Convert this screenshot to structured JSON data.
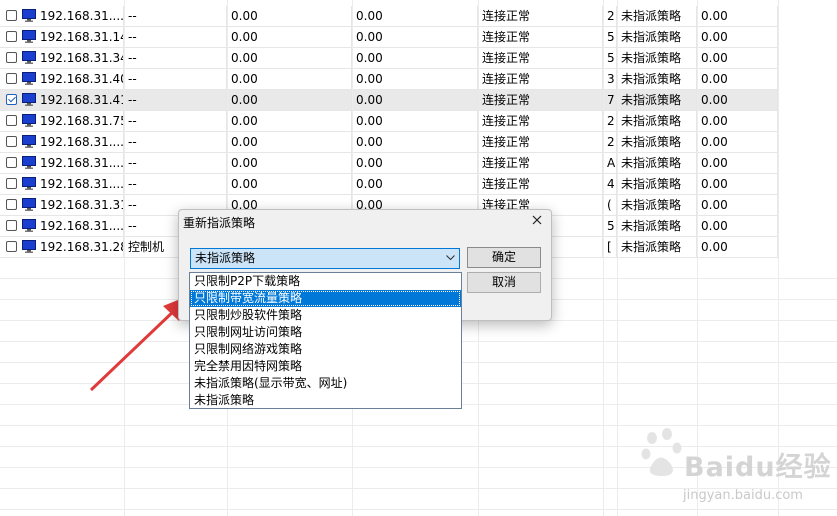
{
  "table": {
    "rows": [
      {
        "checked": false,
        "ip": "192.168.31....",
        "name": "--",
        "v1": "0.00",
        "v2": "0.00",
        "status": "连接正常",
        "col6": "2",
        "policy": "未指派策略",
        "v3": "0.00"
      },
      {
        "checked": false,
        "ip": "192.168.31.14",
        "name": "--",
        "v1": "0.00",
        "v2": "0.00",
        "status": "连接正常",
        "col6": "5",
        "policy": "未指派策略",
        "v3": "0.00"
      },
      {
        "checked": false,
        "ip": "192.168.31.34",
        "name": "--",
        "v1": "0.00",
        "v2": "0.00",
        "status": "连接正常",
        "col6": "5",
        "policy": "未指派策略",
        "v3": "0.00"
      },
      {
        "checked": false,
        "ip": "192.168.31.40",
        "name": "--",
        "v1": "0.00",
        "v2": "0.00",
        "status": "连接正常",
        "col6": "3",
        "policy": "未指派策略",
        "v3": "0.00"
      },
      {
        "checked": true,
        "ip": "192.168.31.41",
        "name": "--",
        "v1": "0.00",
        "v2": "0.00",
        "status": "连接正常",
        "col6": "7",
        "policy": "未指派策略",
        "v3": "0.00"
      },
      {
        "checked": false,
        "ip": "192.168.31.75",
        "name": "--",
        "v1": "0.00",
        "v2": "0.00",
        "status": "连接正常",
        "col6": "2",
        "policy": "未指派策略",
        "v3": "0.00"
      },
      {
        "checked": false,
        "ip": "192.168.31....",
        "name": "--",
        "v1": "0.00",
        "v2": "0.00",
        "status": "连接正常",
        "col6": "2",
        "policy": "未指派策略",
        "v3": "0.00"
      },
      {
        "checked": false,
        "ip": "192.168.31....",
        "name": "--",
        "v1": "0.00",
        "v2": "0.00",
        "status": "连接正常",
        "col6": "A",
        "policy": "未指派策略",
        "v3": "0.00"
      },
      {
        "checked": false,
        "ip": "192.168.31....",
        "name": "--",
        "v1": "0.00",
        "v2": "0.00",
        "status": "连接正常",
        "col6": "4",
        "policy": "未指派策略",
        "v3": "0.00"
      },
      {
        "checked": false,
        "ip": "192.168.31.31",
        "name": "--",
        "v1": "0.00",
        "v2": "0.00",
        "status": "连接正常",
        "col6": "(",
        "policy": "未指派策略",
        "v3": "0.00"
      },
      {
        "checked": false,
        "ip": "192.168.31....",
        "name": "--",
        "v1": "",
        "v2": "",
        "status": "",
        "col6": "5",
        "policy": "未指派策略",
        "v3": "0.00"
      },
      {
        "checked": false,
        "ip": "192.168.31.28",
        "name": "控制机",
        "v1": "",
        "v2": "",
        "status": "",
        "col6": "[",
        "policy": "未指派策略",
        "v3": "0.00"
      }
    ]
  },
  "dialog": {
    "title": "重新指派策略",
    "combo_value": "未指派策略",
    "ok_label": "确定",
    "cancel_label": "取消",
    "options": [
      "只限制P2P下载策略",
      "只限制带宽流量策略",
      "只限制炒股软件策略",
      "只限制网址访问策略",
      "只限制网络游戏策略",
      "完全禁用因特网策略",
      "未指派策略(显示带宽、网址)",
      "未指派策略"
    ],
    "highlighted_index": 1
  },
  "watermark": {
    "brand": "Baidu经验",
    "url": "jingyan.baidu.com"
  },
  "colors": {
    "accent": "#0078d7",
    "arrow": "#e03a3a",
    "pc_icon": "#1a3fcf"
  }
}
